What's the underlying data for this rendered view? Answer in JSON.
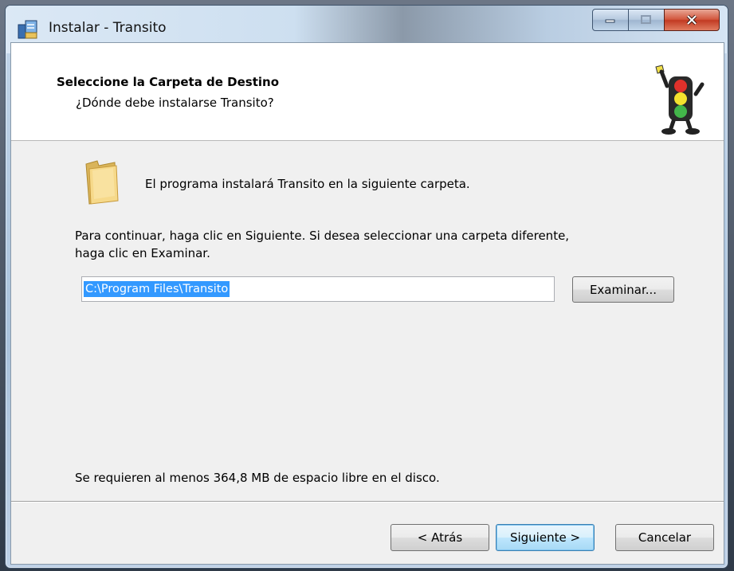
{
  "window": {
    "title": "Instalar - Transito"
  },
  "header": {
    "title": "Seleccione la Carpeta de Destino",
    "subtitle": "¿Dónde debe instalarse Transito?"
  },
  "body": {
    "folder_message": "El programa instalará Transito en la siguiente carpeta.",
    "instruction_line1": "Para continuar, haga clic en Siguiente. Si desea seleccionar una carpeta diferente,",
    "instruction_line2": "haga clic en Examinar.",
    "path_value": "C:\\Program Files\\Transito",
    "browse_label": "Examinar...",
    "space_required": "Se requieren al menos 364,8 MB de espacio libre en el disco."
  },
  "footer": {
    "back_label": "< Atrás",
    "next_label": "Siguiente >",
    "cancel_label": "Cancelar"
  },
  "icons": {
    "app_icon": "installer-icon",
    "logo": "traffic-light-icon",
    "folder": "folder-icon"
  },
  "colors": {
    "selection": "#3399ff",
    "dialog_bg": "#f0f0f0",
    "header_bg": "#ffffff",
    "close_button": "#c23a22"
  }
}
